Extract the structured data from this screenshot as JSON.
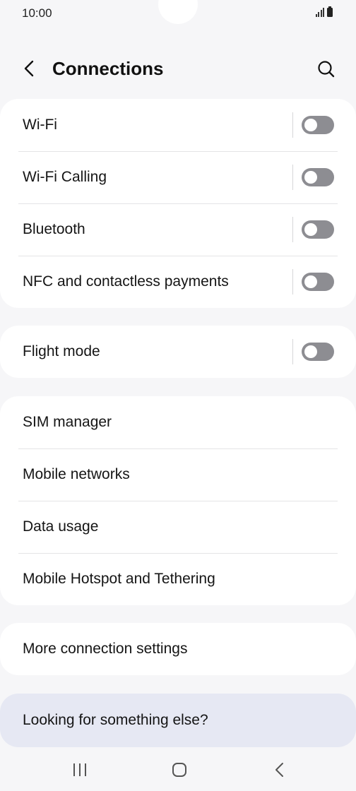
{
  "status_bar": {
    "time": "10:00",
    "icons": [
      "signal-icon",
      "battery-icon"
    ]
  },
  "header": {
    "title": "Connections",
    "back_icon": "chevron-left-icon",
    "search_icon": "search-icon"
  },
  "groups": {
    "radios": [
      {
        "label": "Wi-Fi",
        "toggle_on": false
      },
      {
        "label": "Wi-Fi Calling",
        "toggle_on": false
      },
      {
        "label": "Bluetooth",
        "toggle_on": false
      },
      {
        "label": "NFC and contactless payments",
        "toggle_on": false
      }
    ],
    "flight": [
      {
        "label": "Flight mode",
        "toggle_on": false
      }
    ],
    "networks": [
      {
        "label": "SIM manager"
      },
      {
        "label": "Mobile networks"
      },
      {
        "label": "Data usage"
      },
      {
        "label": "Mobile Hotspot and Tethering"
      }
    ],
    "more": [
      {
        "label": "More connection settings"
      }
    ]
  },
  "suggestion": {
    "label": "Looking for something else?"
  },
  "nav_bar": {
    "icons": [
      "recent-apps-icon",
      "home-icon",
      "back-icon"
    ]
  },
  "colors": {
    "background": "#f6f6f8",
    "card": "#ffffff",
    "toggle_off": "#8d8d92",
    "suggestion_card": "#e6e8f3"
  }
}
